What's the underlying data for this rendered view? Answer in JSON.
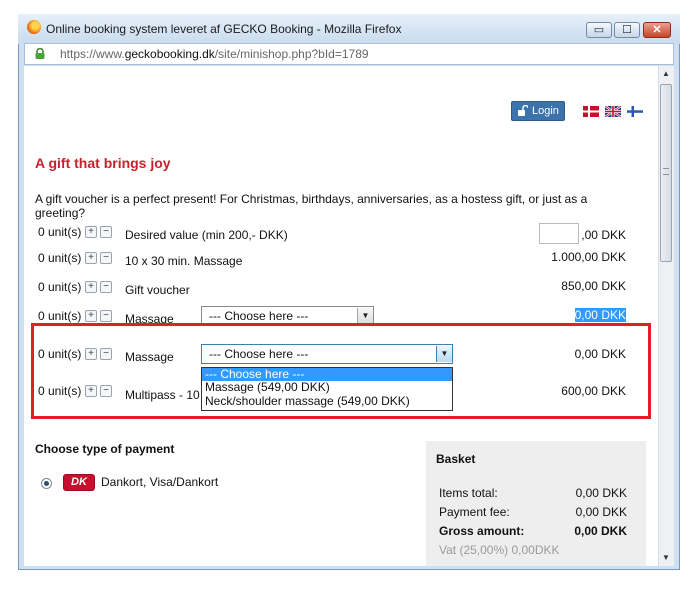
{
  "window": {
    "title": "Online booking system leveret af GECKO Booking - Mozilla Firefox",
    "url_prefix": "https://www.",
    "url_domain": "geckobooking.dk",
    "url_path": "/site/minishop.php?bId=1789",
    "min_glyph": "▭",
    "max_glyph": "☐",
    "close_glyph": "✕"
  },
  "header": {
    "login_label": "Login",
    "flags": [
      "danish-flag",
      "british-flag",
      "finnish-flag"
    ]
  },
  "page": {
    "title": "A gift that brings joy",
    "intro": "A gift voucher is a perfect present! For Christmas, birthdays, anniversaries, as a hostess gift, or just as a greeting?"
  },
  "stepper": {
    "plus": "+",
    "minus": "−"
  },
  "products": [
    {
      "units": "0 unit(s)",
      "label": "Desired value (min 200,- DKK)",
      "price": ",00 DKK"
    },
    {
      "units": "0 unit(s)",
      "label": "10 x 30 min. Massage",
      "price": "1.000,00 DKK"
    },
    {
      "units": "0 unit(s)",
      "label": "Gift voucher",
      "price": "850,00 DKK"
    },
    {
      "units": "0 unit(s)",
      "label": "Massage",
      "select_value": "--- Choose here ---",
      "price": "0,00 DKK"
    },
    {
      "units": "0 unit(s)",
      "label": "Massage",
      "select_value": "--- Choose here ---",
      "price": "0,00 DKK"
    },
    {
      "units": "0 unit(s)",
      "label": "Multipass - 10",
      "price": "600,00 DKK"
    }
  ],
  "dropdown": {
    "options": [
      "--- Choose here ---",
      "Massage (549,00 DKK)",
      "Neck/shoulder massage (549,00 DKK)"
    ],
    "highlighted_index": 0
  },
  "payment": {
    "title": "Choose type of payment",
    "logo_text": "DK",
    "option_label": "Dankort, Visa/Dankort"
  },
  "basket": {
    "title": "Basket",
    "rows": [
      {
        "label": "Items total:",
        "value": "0,00 DKK"
      },
      {
        "label": "Payment fee:",
        "value": "0,00 DKK"
      },
      {
        "label": "Gross amount:",
        "value": "0,00 DKK"
      }
    ],
    "vat": "Vat (25,00%) 0,00DKK"
  },
  "scrollbar": {
    "up": "▲",
    "down": "▼"
  },
  "colors": {
    "accent_red": "#c8202c",
    "highlight_blue": "#3399ff",
    "login_blue": "#3d73ad"
  }
}
